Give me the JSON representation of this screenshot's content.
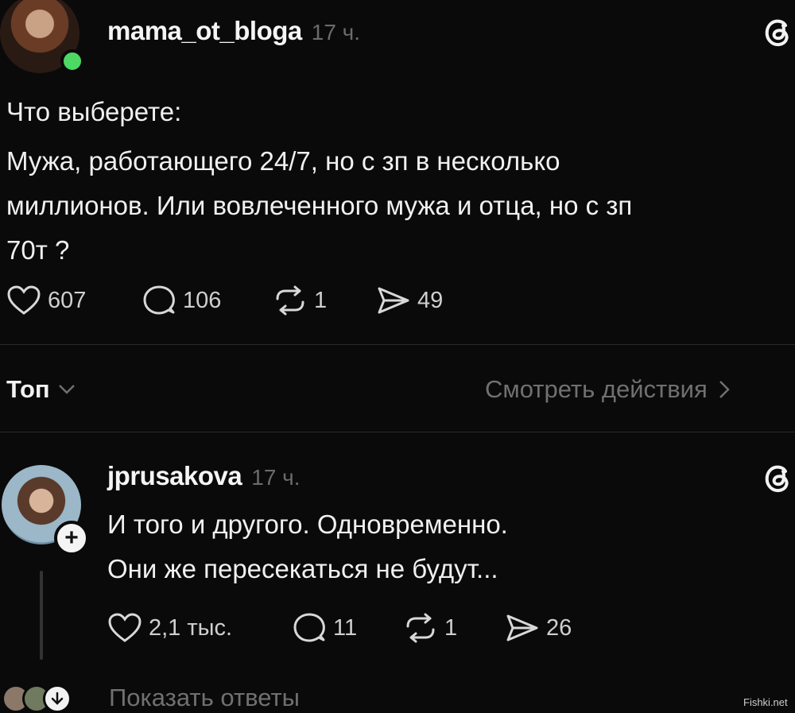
{
  "post": {
    "username": "mama_ot_bloga",
    "time": "17 ч.",
    "text_line1": "Что выберете:",
    "text_line2": "Мужа, работающего 24/7, но с зп в несколько",
    "text_line3": "миллионов. Или вовлеченного мужа и отца, но с зп",
    "text_line4": "70т ?",
    "likes": "607",
    "comments": "106",
    "reposts": "1",
    "shares": "49"
  },
  "sort_bar": {
    "label": "Топ",
    "activity_link": "Смотреть действия"
  },
  "reply": {
    "username": "jprusakova",
    "time": "17 ч.",
    "text_line1": "И того и другого. Одновременно.",
    "text_line2": "Они же пересекаться не будут...",
    "likes": "2,1 тыс.",
    "comments": "11",
    "reposts": "1",
    "shares": "26",
    "show_replies": "Показать ответы"
  },
  "watermark": "Fishki.net",
  "icons": [
    "threads-logo-icon",
    "heart-icon",
    "comment-icon",
    "repost-icon",
    "share-icon",
    "chevron-down-icon",
    "chevron-right-icon",
    "plus-icon",
    "arrow-down-icon"
  ],
  "colors": {
    "background": "#0a0a0a",
    "online": "#4cd964",
    "muted": "#707070"
  }
}
